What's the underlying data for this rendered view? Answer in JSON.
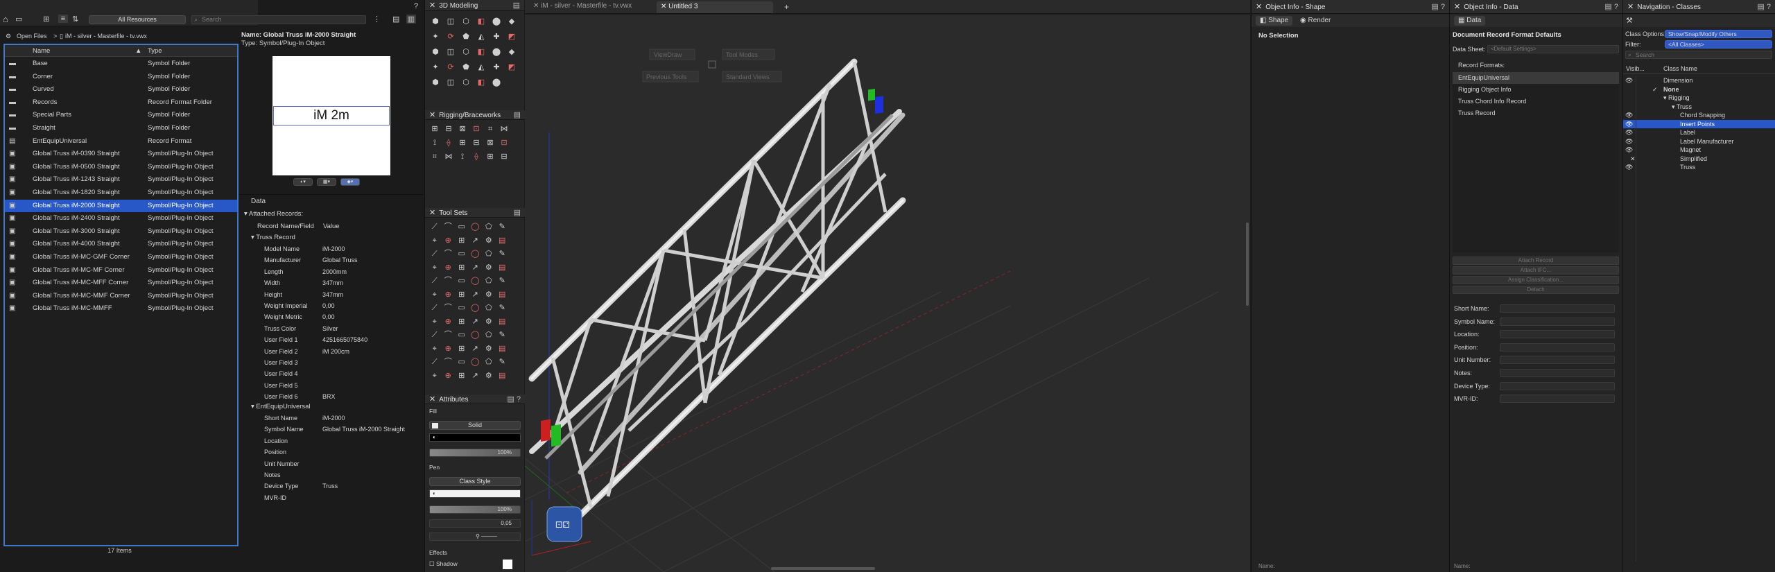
{
  "toolbar": {
    "resource_filter": "All Resources",
    "search_placeholder": "Search",
    "help": "?"
  },
  "breadcrumb": {
    "root": "Open Files",
    "sep": ">",
    "file": "iM - silver - Masterfile - tv.vwx"
  },
  "resource_list": {
    "col_name": "Name",
    "col_type": "Type",
    "rows": [
      {
        "name": "Base",
        "type": "Symbol Folder",
        "kind": "folder"
      },
      {
        "name": "Corner",
        "type": "Symbol Folder",
        "kind": "folder"
      },
      {
        "name": "Curved",
        "type": "Symbol Folder",
        "kind": "folder"
      },
      {
        "name": "Records",
        "type": "Record Format Folder",
        "kind": "folder"
      },
      {
        "name": "Special Parts",
        "type": "Symbol Folder",
        "kind": "folder"
      },
      {
        "name": "Straight",
        "type": "Symbol Folder",
        "kind": "folder"
      },
      {
        "name": "EntEquipUniversal",
        "type": "Record Format",
        "kind": "record"
      },
      {
        "name": "Global Truss iM-0390 Straight",
        "type": "Symbol/Plug-In Object",
        "kind": "symbol"
      },
      {
        "name": "Global Truss iM-0500 Straight",
        "type": "Symbol/Plug-In Object",
        "kind": "symbol"
      },
      {
        "name": "Global Truss iM-1243 Straight",
        "type": "Symbol/Plug-In Object",
        "kind": "symbol"
      },
      {
        "name": "Global Truss iM-1820 Straight",
        "type": "Symbol/Plug-In Object",
        "kind": "symbol"
      },
      {
        "name": "Global Truss iM-2000 Straight",
        "type": "Symbol/Plug-In Object",
        "kind": "symbol",
        "selected": true
      },
      {
        "name": "Global Truss iM-2400 Straight",
        "type": "Symbol/Plug-In Object",
        "kind": "symbol"
      },
      {
        "name": "Global Truss iM-3000 Straight",
        "type": "Symbol/Plug-In Object",
        "kind": "symbol"
      },
      {
        "name": "Global Truss iM-4000 Straight",
        "type": "Symbol/Plug-In Object",
        "kind": "symbol"
      },
      {
        "name": "Global Truss iM-MC-GMF Corner",
        "type": "Symbol/Plug-In Object",
        "kind": "symbol"
      },
      {
        "name": "Global Truss iM-MC-MF Corner",
        "type": "Symbol/Plug-In Object",
        "kind": "symbol"
      },
      {
        "name": "Global Truss iM-MC-MFF Corner",
        "type": "Symbol/Plug-In Object",
        "kind": "symbol"
      },
      {
        "name": "Global Truss iM-MC-MMF Corner",
        "type": "Symbol/Plug-In Object",
        "kind": "symbol"
      },
      {
        "name": "Global Truss iM-MC-MMFF",
        "type": "Symbol/Plug-In Object",
        "kind": "symbol"
      }
    ],
    "count": "17 Items"
  },
  "preview": {
    "name_line": "Name: Global Truss iM-2000 Straight",
    "type_line": "Type: Symbol/Plug-In Object",
    "thumb_text": "iM 2m"
  },
  "data_panel": {
    "header": "Data",
    "attached": "Attached Records:",
    "col1": "Record Name/Field",
    "col2": "Value",
    "truss_record": "Truss Record",
    "truss_fields": [
      {
        "k": "Model Name",
        "v": "iM-2000"
      },
      {
        "k": "Manufacturer",
        "v": "Global Truss"
      },
      {
        "k": "Length",
        "v": "2000mm"
      },
      {
        "k": "Width",
        "v": "347mm"
      },
      {
        "k": "Height",
        "v": "347mm"
      },
      {
        "k": "Weight Imperial",
        "v": "0,00"
      },
      {
        "k": "Weight Metric",
        "v": "0,00"
      },
      {
        "k": "Truss Color",
        "v": "Silver"
      },
      {
        "k": "User Field 1",
        "v": "4251665075840"
      },
      {
        "k": "User Field 2",
        "v": "iM 200cm"
      },
      {
        "k": "User Field 3",
        "v": ""
      },
      {
        "k": "User Field 4",
        "v": ""
      },
      {
        "k": "User Field 5",
        "v": ""
      },
      {
        "k": "User Field 6",
        "v": "BRX"
      }
    ],
    "ent_record": "EntEquipUniversal",
    "ent_fields": [
      {
        "k": "Short Name",
        "v": "iM-2000"
      },
      {
        "k": "Symbol Name",
        "v": "Global Truss iM-2000 Straight"
      },
      {
        "k": "Location",
        "v": ""
      },
      {
        "k": "Position",
        "v": ""
      },
      {
        "k": "Unit Number",
        "v": ""
      },
      {
        "k": "Notes",
        "v": ""
      },
      {
        "k": "Device Type",
        "v": "Truss"
      },
      {
        "k": "MVR-ID",
        "v": ""
      }
    ]
  },
  "palettes": {
    "modeling": "3D Modeling",
    "rigging": "Rigging/Braceworks",
    "toolsets": "Tool Sets",
    "attributes": "Attributes"
  },
  "attributes": {
    "fill": "Fill",
    "fill_style": "Solid",
    "opacity1": "100%",
    "pen": "Pen",
    "pen_style": "Class Style",
    "opacity2": "100%",
    "thickness": "0,05",
    "effects": "Effects",
    "shadow": "Shadow"
  },
  "tabs": [
    {
      "label": "iM - silver - Masterfile - tv.vwx",
      "active": false
    },
    {
      "label": "Untitled 3",
      "active": true
    }
  ],
  "viewport": {
    "viewdraw": "ViewDraw",
    "tool_modes": "Tool Modes",
    "previous_tools": "Previous Tools",
    "standard_views": "Standard Views"
  },
  "oi_shape": {
    "title": "Object Info - Shape",
    "tab1": "Shape",
    "tab2": "Render",
    "status": "No Selection",
    "footer": "Name:"
  },
  "oi_data": {
    "title": "Object Info - Data",
    "tab": "Data",
    "heading": "Document Record Format Defaults",
    "sheet_label": "Data Sheet:",
    "sheet_value": "<Default Settings>",
    "formats_label": "Record Formats:",
    "formats": [
      "EntEquipUniversal",
      "Rigging Object Info",
      "Truss Chord Info Record",
      "Truss Record"
    ],
    "buttons": [
      "Attach Record",
      "Attach IFC...",
      "Assign Classification...",
      "Detach"
    ],
    "fields": [
      "Short Name:",
      "Symbol Name:",
      "Location:",
      "Position:",
      "Unit Number:",
      "Notes:",
      "Device Type:",
      "MVR-ID:"
    ],
    "footer": "Name:"
  },
  "nav": {
    "title": "Navigation - Classes",
    "options_label": "Class Options:",
    "options_value": "Show/Snap/Modify Others",
    "filter_label": "Filter:",
    "filter_value": "<All Classes>",
    "search_placeholder": "Search",
    "col_vis": "Visib...",
    "col_name": "Class Name",
    "classes": [
      {
        "name": "Dimension",
        "indent": 0,
        "vis": true
      },
      {
        "name": "None",
        "indent": 0,
        "vis": false,
        "check": true,
        "bold": true
      },
      {
        "name": "▾ Rigging",
        "indent": 0,
        "vis": false
      },
      {
        "name": "▾ Truss",
        "indent": 1,
        "vis": false
      },
      {
        "name": "Chord Snapping",
        "indent": 2,
        "vis": true
      },
      {
        "name": "Insert Points",
        "indent": 2,
        "vis": true,
        "selected": true
      },
      {
        "name": "Label",
        "indent": 2,
        "vis": true
      },
      {
        "name": "Label Manufacturer",
        "indent": 2,
        "vis": true
      },
      {
        "name": "Magnet",
        "indent": 2,
        "vis": true
      },
      {
        "name": "Simplified",
        "indent": 2,
        "vis": false,
        "cross": true
      },
      {
        "name": "Truss",
        "indent": 2,
        "vis": true
      }
    ]
  },
  "colors": {
    "selection": "#2858c8",
    "accent": "#4a90d9",
    "red": "#d02020",
    "green": "#22bb22",
    "blue": "#2030e0"
  }
}
